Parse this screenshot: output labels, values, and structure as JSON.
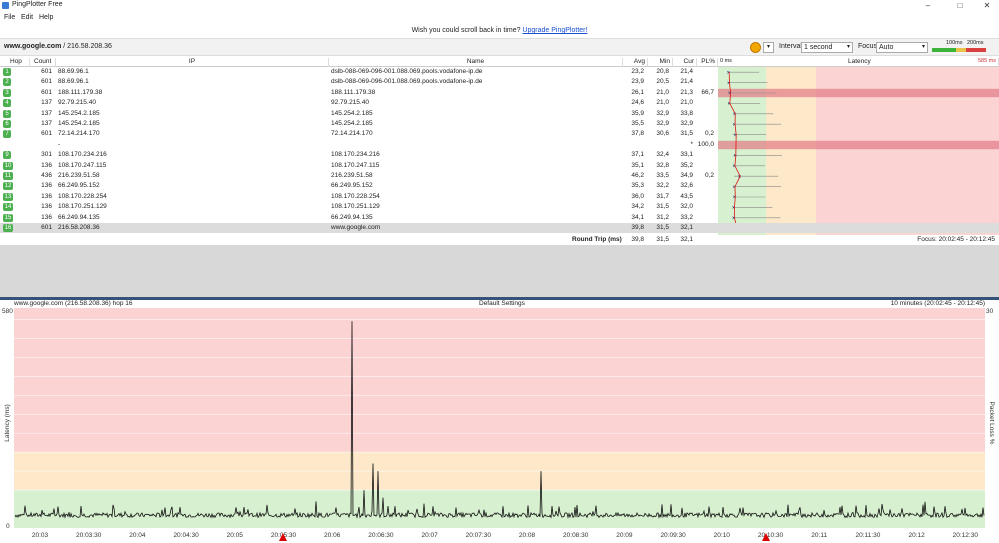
{
  "window": {
    "title": "PingPlotter Free",
    "min": "–",
    "max": "□",
    "close": "✕"
  },
  "menu": [
    "File",
    "Edit",
    "Help"
  ],
  "promo": {
    "text": "Wish you could scroll back in time?",
    "link": "Upgrade PingPlotter!"
  },
  "toolbar": {
    "target": "www.google.com",
    "target_ip": " / 216.58.208.36",
    "interval_label": "Interval",
    "interval_value": "1 second",
    "focus_label": "Focus",
    "focus_value": "Auto",
    "scale_low": "100ms",
    "scale_high": "200ms"
  },
  "grid": {
    "headers": {
      "hop": "Hop",
      "count": "Count",
      "ip": "IP",
      "name": "Name",
      "avg": "Avg",
      "min": "Min",
      "cur": "Cur",
      "pl": "PL%",
      "lat_left": "0 ms",
      "latency": "Latency",
      "lat_right": "585 ms"
    },
    "rows": [
      {
        "hop": "1",
        "count": "601",
        "ip": "88.69.96.1",
        "name": "dslb-088-069-096-001.088.069.pools.vodafone-ip.de",
        "avg": "23,2",
        "min": "20,8",
        "cur": "21,4",
        "pl": ""
      },
      {
        "hop": "2",
        "count": "601",
        "ip": "88.69.96.1",
        "name": "dslb-088-069-096-001.088.069.pools.vodafone-ip.de",
        "avg": "23,9",
        "min": "20,5",
        "cur": "21,4",
        "pl": ""
      },
      {
        "hop": "3",
        "count": "601",
        "ip": "188.111.179.38",
        "name": "188.111.179.38",
        "avg": "26,1",
        "min": "21,0",
        "cur": "21,3",
        "pl": "66,7"
      },
      {
        "hop": "4",
        "count": "137",
        "ip": "92.79.215.40",
        "name": "92.79.215.40",
        "avg": "24,6",
        "min": "21,0",
        "cur": "21,0",
        "pl": ""
      },
      {
        "hop": "5",
        "count": "137",
        "ip": "145.254.2.185",
        "name": "145.254.2.185",
        "avg": "35,9",
        "min": "32,9",
        "cur": "33,8",
        "pl": ""
      },
      {
        "hop": "6",
        "count": "137",
        "ip": "145.254.2.185",
        "name": "145.254.2.185",
        "avg": "35,5",
        "min": "32,9",
        "cur": "32,9",
        "pl": ""
      },
      {
        "hop": "7",
        "count": "601",
        "ip": "72.14.214.170",
        "name": "72.14.214.170",
        "avg": "37,8",
        "min": "30,6",
        "cur": "31,5",
        "pl": "0,2"
      },
      {
        "hop": "",
        "count": "",
        "ip": "-",
        "name": "",
        "avg": "",
        "min": "",
        "cur": "*",
        "pl": "100,0"
      },
      {
        "hop": "9",
        "count": "301",
        "ip": "108.170.234.216",
        "name": "108.170.234.216",
        "avg": "37,1",
        "min": "32,4",
        "cur": "33,1",
        "pl": ""
      },
      {
        "hop": "10",
        "count": "136",
        "ip": "108.170.247.115",
        "name": "108.170.247.115",
        "avg": "35,1",
        "min": "32,8",
        "cur": "35,2",
        "pl": ""
      },
      {
        "hop": "11",
        "count": "436",
        "ip": "216.239.51.58",
        "name": "216.239.51.58",
        "avg": "46,2",
        "min": "33,5",
        "cur": "34,9",
        "pl": "0,2"
      },
      {
        "hop": "12",
        "count": "136",
        "ip": "66.249.95.152",
        "name": "66.249.95.152",
        "avg": "35,3",
        "min": "32,2",
        "cur": "32,6",
        "pl": ""
      },
      {
        "hop": "13",
        "count": "136",
        "ip": "108.170.228.254",
        "name": "108.170.228.254",
        "avg": "36,0",
        "min": "31,7",
        "cur": "43,5",
        "pl": ""
      },
      {
        "hop": "14",
        "count": "136",
        "ip": "108.170.251.129",
        "name": "108.170.251.129",
        "avg": "34,2",
        "min": "31,5",
        "cur": "32,0",
        "pl": ""
      },
      {
        "hop": "15",
        "count": "136",
        "ip": "66.249.94.135",
        "name": "66.249.94.135",
        "avg": "34,1",
        "min": "31,2",
        "cur": "33,2",
        "pl": ""
      },
      {
        "hop": "16",
        "count": "601",
        "ip": "216.58.208.36",
        "name": "www.google.com",
        "avg": "39,8",
        "min": "31,5",
        "cur": "32,1",
        "pl": ""
      }
    ],
    "round_trip": {
      "label": "Round Trip (ms)",
      "avg": "39,8",
      "min": "31,5",
      "cur": "32,1"
    },
    "focus_range": "Focus: 20:02:45 - 20:12:45"
  },
  "graph": {
    "left_title": "www.google.com (216.58.208.36) hop 16",
    "center_title": "Default Settings",
    "right_title": "10 minutes (20:02:45 - 20:12:45)",
    "y_max": "580",
    "y_min": "0",
    "right_max": "30",
    "y_axis_label": "Latency (ms)",
    "right_axis_label": "Packet Loss %",
    "x_ticks": [
      "20:03",
      "20:03:30",
      "20:04",
      "20:04:30",
      "20:05",
      "20:05:30",
      "20:06",
      "20:06:30",
      "20:07",
      "20:07:30",
      "20:08",
      "20:08:30",
      "20:09",
      "20:09:30",
      "20:10",
      "20:10:30",
      "20:11",
      "20:11:30",
      "20:12",
      "20:12:30"
    ]
  },
  "colors": {
    "green": "#d7f0cf",
    "yellow": "#fde9c9",
    "red": "#fbd3d3",
    "badge": "#4caf50",
    "divider": "#35537a"
  }
}
